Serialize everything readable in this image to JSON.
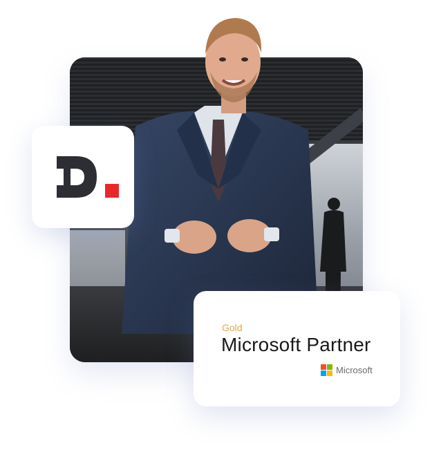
{
  "brand": {
    "logo_icon": "d-dot-logo-icon",
    "logo_letter_color": "#2d2e33",
    "logo_accent_color": "#e8282b"
  },
  "partner_badge": {
    "tier": "Gold",
    "title": "Microsoft Partner",
    "vendor": "Microsoft",
    "tier_color": "#e3a64a",
    "vendor_logo_colors": [
      "#f25022",
      "#7fba00",
      "#00a4ef",
      "#ffb900"
    ]
  },
  "photo": {
    "subject_icon": "presenter-photo"
  }
}
